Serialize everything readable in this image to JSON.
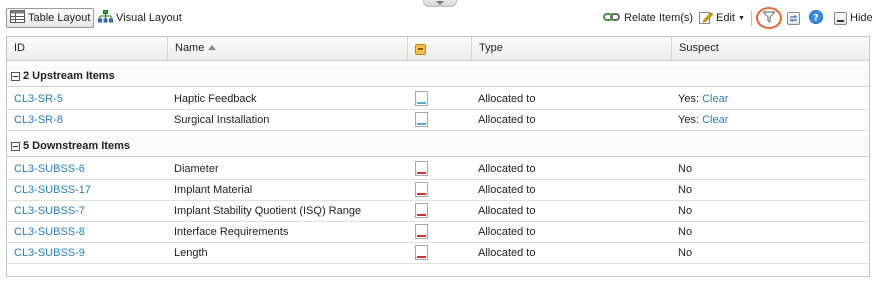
{
  "toolbar": {
    "table_layout_label": "Table Layout",
    "visual_layout_label": "Visual Layout",
    "relate_items_label": "Relate Item(s)",
    "edit_label": "Edit",
    "hide_label": "Hide",
    "accent_color": "#e8632d"
  },
  "columns": {
    "id": "ID",
    "name": "Name",
    "type": "Type",
    "suspect": "Suspect"
  },
  "groups": [
    {
      "label": "2 Upstream Items",
      "rows": [
        {
          "id": "CL3-SR-5",
          "name": "Haptic Feedback",
          "type": "Allocated to",
          "suspect": "Yes:",
          "suspect_link": "Clear",
          "icon": "blue-document-icon"
        },
        {
          "id": "CL3-SR-8",
          "name": "Surgical Installation",
          "type": "Allocated to",
          "suspect": "Yes:",
          "suspect_link": "Clear",
          "icon": "blue-document-icon"
        }
      ]
    },
    {
      "label": "5 Downstream Items",
      "rows": [
        {
          "id": "CL3-SUBSS-6",
          "name": "Diameter",
          "type": "Allocated to",
          "suspect": "No",
          "icon": "red-document-icon"
        },
        {
          "id": "CL3-SUBSS-17",
          "name": "Implant Material",
          "type": "Allocated to",
          "suspect": "No",
          "icon": "red-document-icon"
        },
        {
          "id": "CL3-SUBSS-7",
          "name": "Implant Stability Quotient (ISQ) Range",
          "type": "Allocated to",
          "suspect": "No",
          "icon": "red-document-icon"
        },
        {
          "id": "CL3-SUBSS-8",
          "name": "Interface Requirements",
          "type": "Allocated to",
          "suspect": "No",
          "icon": "red-document-icon"
        },
        {
          "id": "CL3-SUBSS-9",
          "name": "Length",
          "type": "Allocated to",
          "suspect": "No",
          "icon": "red-document-icon"
        }
      ]
    }
  ]
}
